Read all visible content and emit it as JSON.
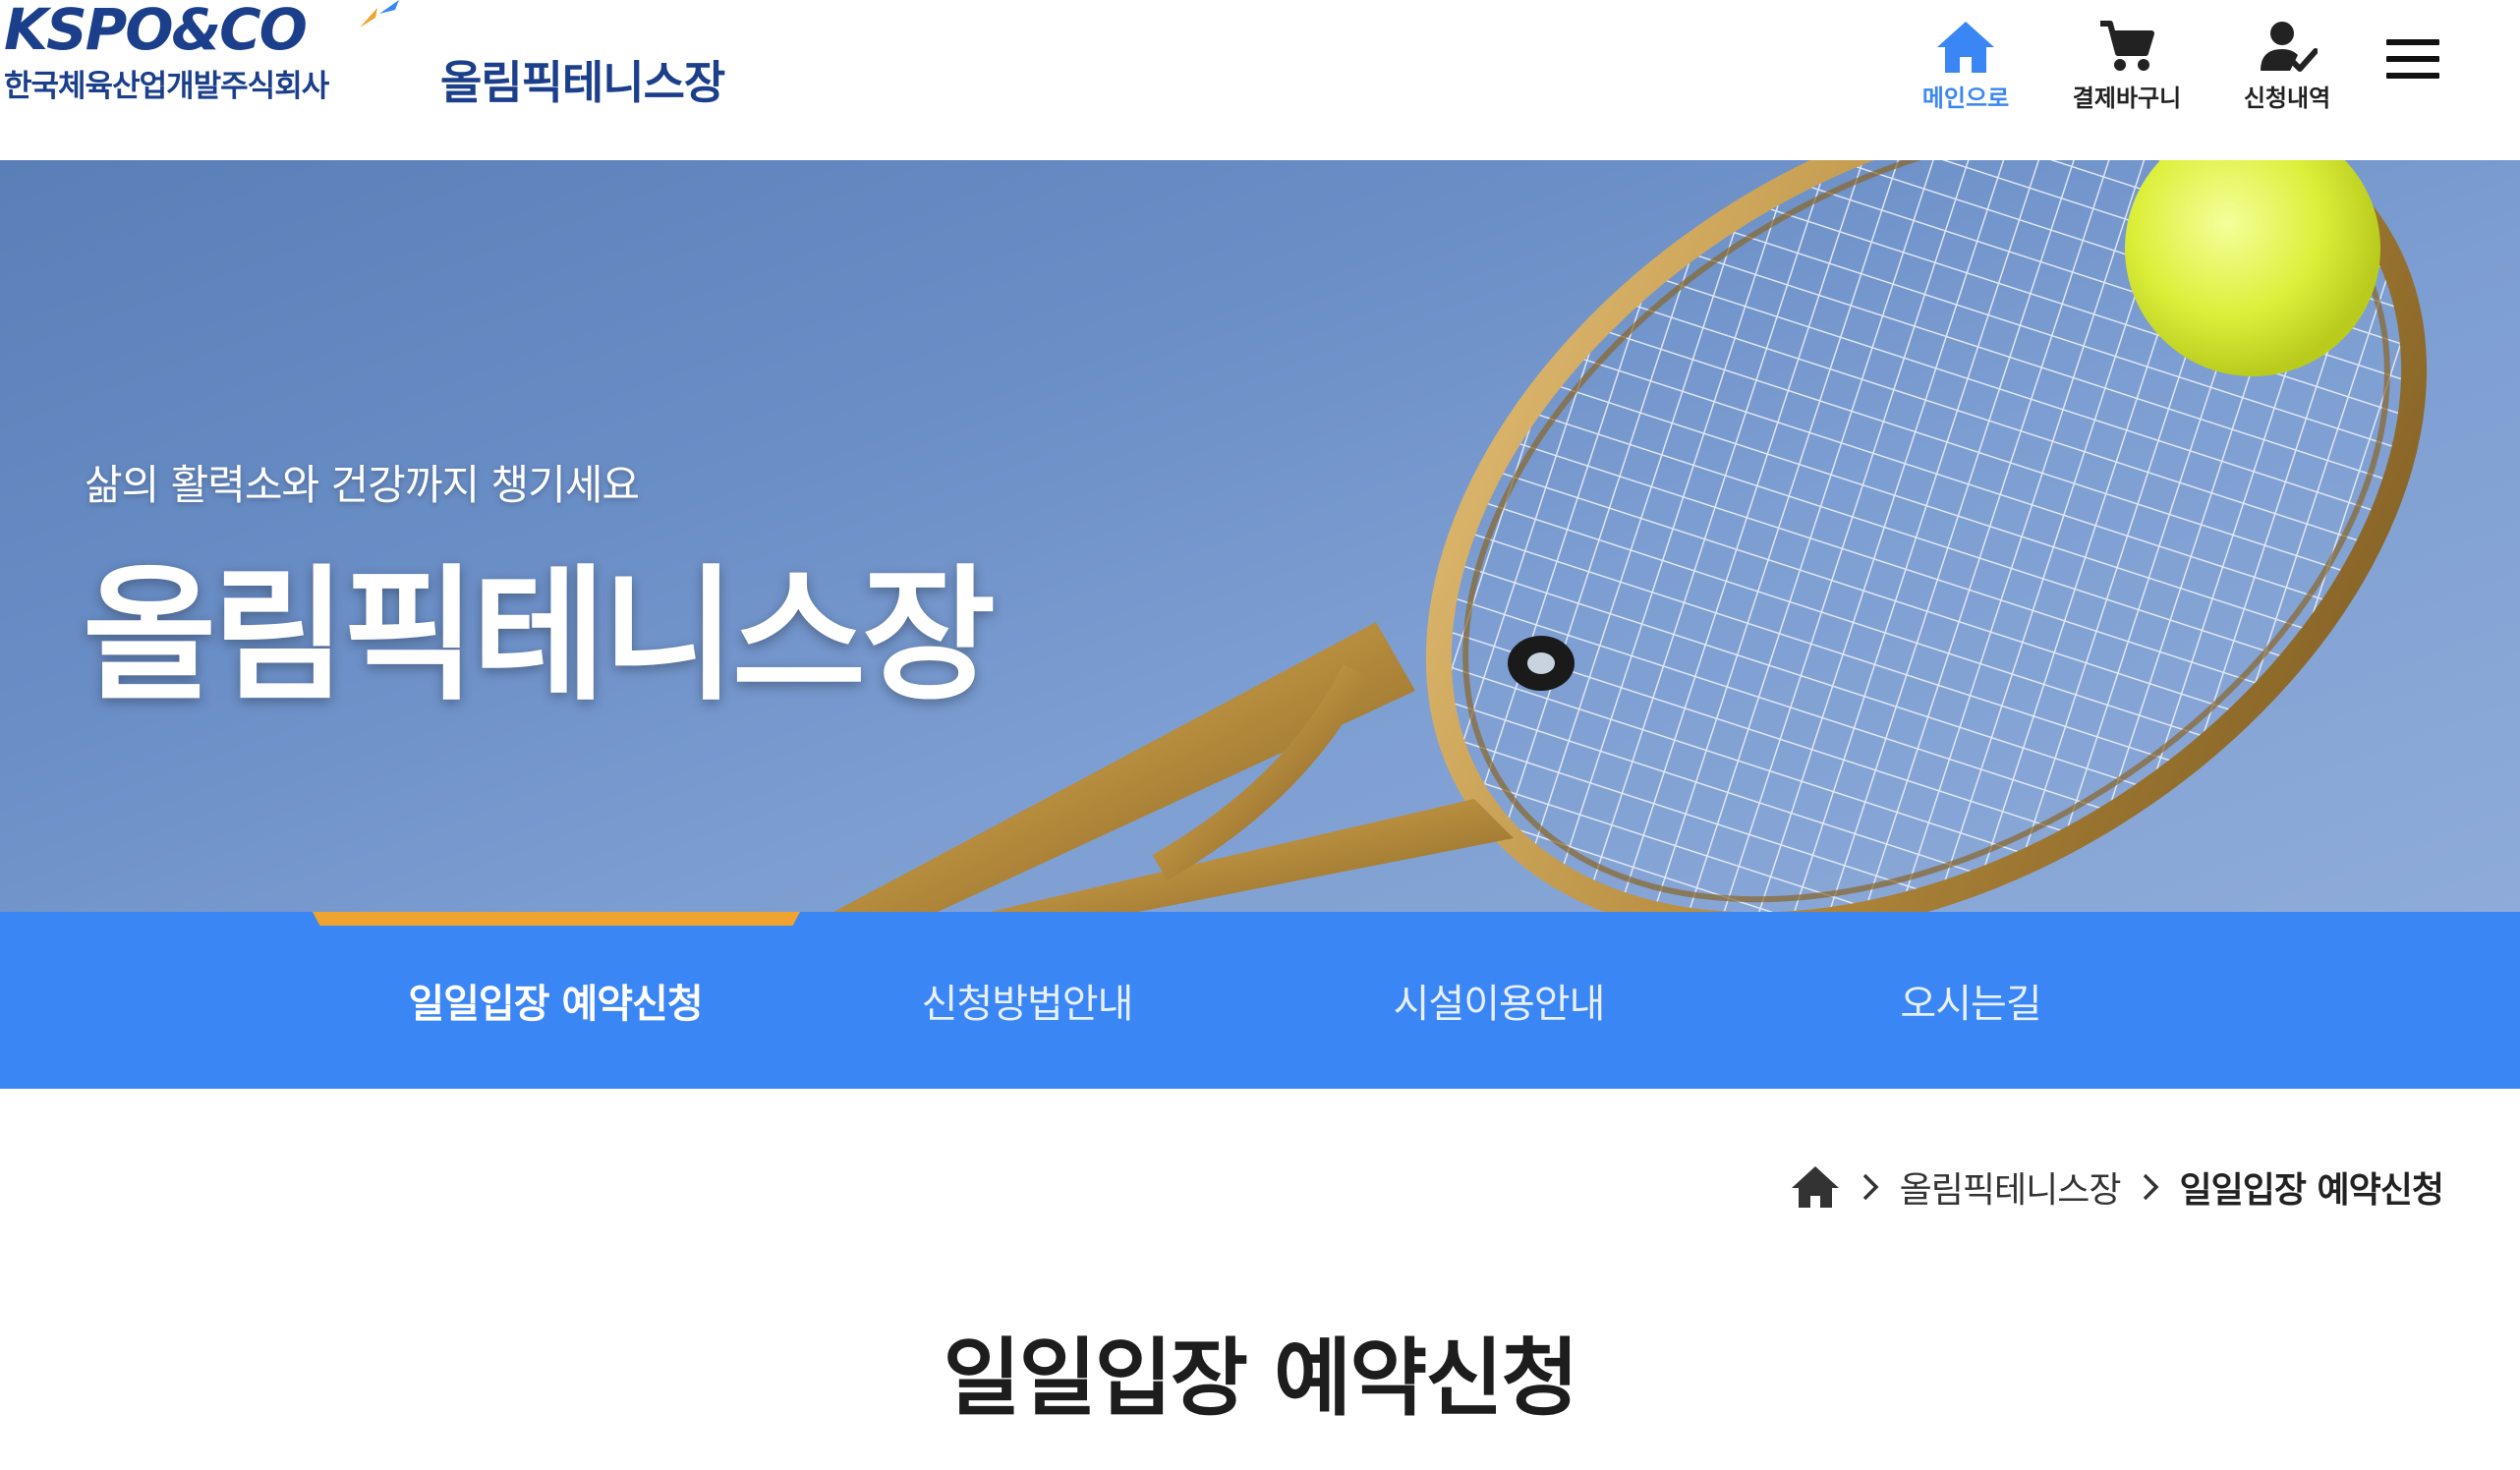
{
  "header": {
    "logo_text": "KSPO&CO",
    "logo_subtitle": "한국체육산업개발주식회사",
    "site_title": "올림픽테니스장",
    "utilities": [
      {
        "label": "메인으로",
        "icon": "home-icon",
        "active": true
      },
      {
        "label": "결제바구니",
        "icon": "cart-icon",
        "active": false
      },
      {
        "label": "신청내역",
        "icon": "user-check-icon",
        "active": false
      }
    ],
    "menu_icon": "hamburger-icon"
  },
  "hero": {
    "subtitle": "삶의 활력소와 건강까지 챙기세요",
    "title": "올림픽테니스장"
  },
  "tabs": [
    {
      "label": "일일입장 예약신청",
      "active": true
    },
    {
      "label": "신청방법안내",
      "active": false
    },
    {
      "label": "시설이용안내",
      "active": false
    },
    {
      "label": "오시는길",
      "active": false
    }
  ],
  "breadcrumb": {
    "home_icon": "home-icon",
    "items": [
      "올림픽테니스장",
      "일일입장 예약신청"
    ]
  },
  "page": {
    "title": "일일입장 예약신청"
  },
  "colors": {
    "brand_navy": "#1b3f8b",
    "tab_bar": "#3b86f5",
    "tab_indicator": "#f0a32e",
    "active_util": "#3b86f5"
  }
}
